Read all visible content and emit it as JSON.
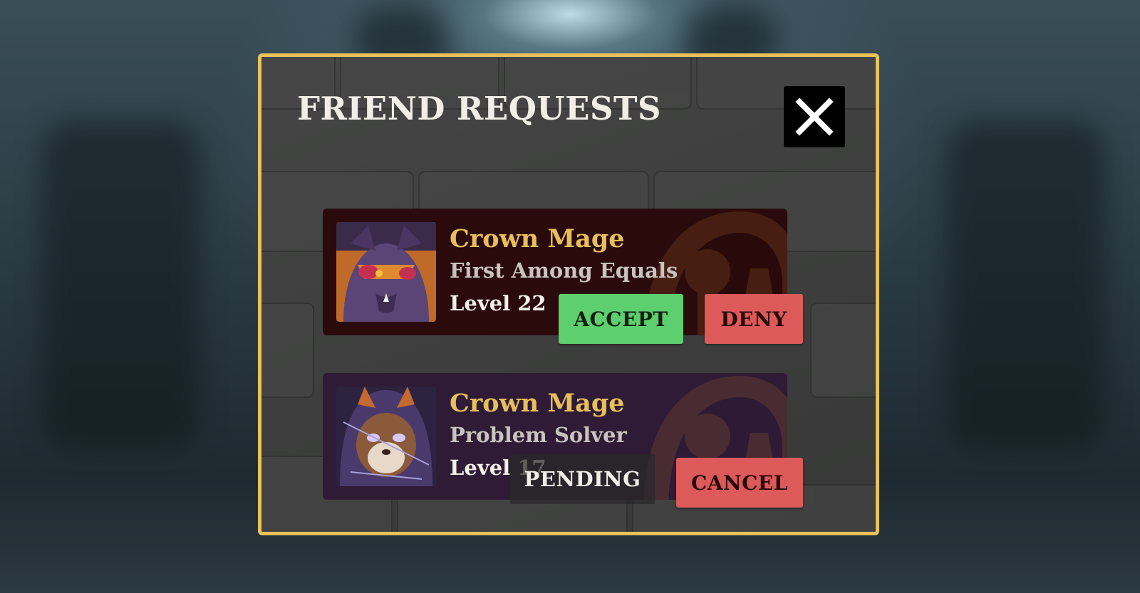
{
  "modal": {
    "title": "FRIEND REQUESTS",
    "close_icon": "close-icon"
  },
  "requests": [
    {
      "name": "Crown Mage",
      "subtitle": "First Among Equals",
      "level": "Level 22",
      "actions": {
        "accept": "ACCEPT",
        "deny": "DENY"
      },
      "card_color": "#2a0a0b"
    },
    {
      "name": "Crown Mage",
      "subtitle": "Problem Solver",
      "level": "Level 17",
      "status": "PENDING",
      "actions": {
        "cancel": "CANCEL"
      },
      "card_color": "#2f1b35"
    }
  ],
  "colors": {
    "border": "#e9c25a",
    "name": "#e6bf5b",
    "accept": "#5ecf6e",
    "deny": "#dc5a5a"
  }
}
